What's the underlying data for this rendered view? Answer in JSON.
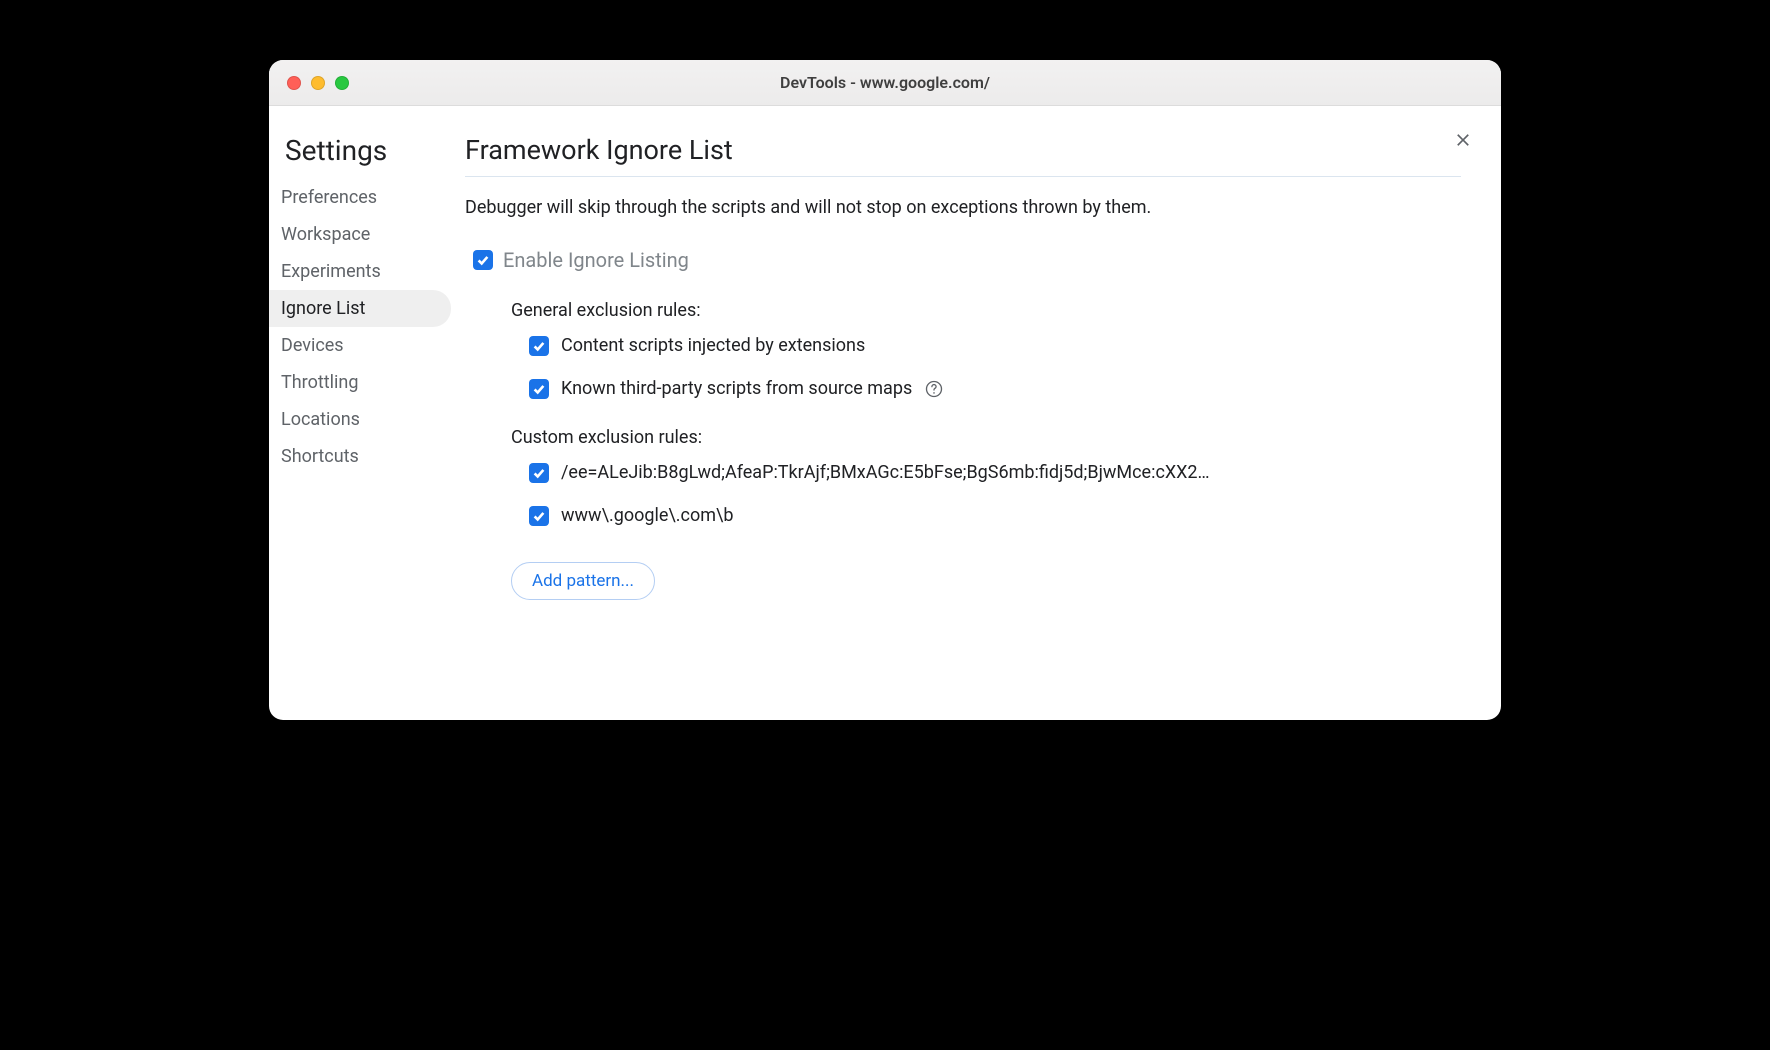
{
  "window": {
    "title": "DevTools - www.google.com/"
  },
  "sidebar": {
    "title": "Settings",
    "items": [
      {
        "label": "Preferences",
        "active": false
      },
      {
        "label": "Workspace",
        "active": false
      },
      {
        "label": "Experiments",
        "active": false
      },
      {
        "label": "Ignore List",
        "active": true
      },
      {
        "label": "Devices",
        "active": false
      },
      {
        "label": "Throttling",
        "active": false
      },
      {
        "label": "Locations",
        "active": false
      },
      {
        "label": "Shortcuts",
        "active": false
      }
    ]
  },
  "main": {
    "title": "Framework Ignore List",
    "description": "Debugger will skip through the scripts and will not stop on exceptions thrown by them.",
    "enable_label": "Enable Ignore Listing",
    "enable_checked": true,
    "general_section_title": "General exclusion rules:",
    "general_rules": [
      {
        "label": "Content scripts injected by extensions",
        "checked": true,
        "has_help": false
      },
      {
        "label": "Known third-party scripts from source maps",
        "checked": true,
        "has_help": true
      }
    ],
    "custom_section_title": "Custom exclusion rules:",
    "custom_rules": [
      {
        "label": "/ee=ALeJib:B8gLwd;AfeaP:TkrAjf;BMxAGc:E5bFse;BgS6mb:fidj5d;BjwMce:cXX2…",
        "checked": true
      },
      {
        "label": "www\\.google\\.com\\b",
        "checked": true
      }
    ],
    "add_pattern_label": "Add pattern..."
  }
}
